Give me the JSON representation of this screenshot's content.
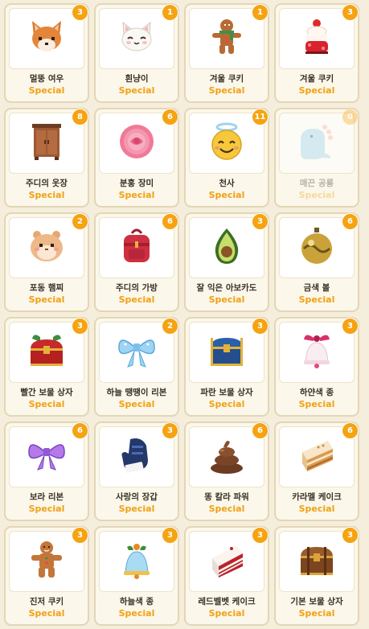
{
  "items": [
    {
      "name": "멀뚱 여우",
      "rarity": "Special",
      "count": "3",
      "icon": "fox-icon",
      "owned": true
    },
    {
      "name": "흰냥이",
      "rarity": "Special",
      "count": "1",
      "icon": "white-cat-icon",
      "owned": true
    },
    {
      "name": "겨울 쿠키",
      "rarity": "Special",
      "count": "1",
      "icon": "gingerbread-icon",
      "owned": true
    },
    {
      "name": "겨울 쿠키",
      "rarity": "Special",
      "count": "3",
      "icon": "cake-cherry-icon",
      "owned": true
    },
    {
      "name": "주디의 옷장",
      "rarity": "Special",
      "count": "8",
      "icon": "wardrobe-icon",
      "owned": true
    },
    {
      "name": "분홍 장미",
      "rarity": "Special",
      "count": "6",
      "icon": "pink-rose-icon",
      "owned": true
    },
    {
      "name": "천사",
      "rarity": "Special",
      "count": "11",
      "icon": "angel-smiley-icon",
      "owned": true
    },
    {
      "name": "매끈 공룡",
      "rarity": "Special",
      "count": "0",
      "icon": "dinosaur-icon",
      "owned": false
    },
    {
      "name": "포동 햄찌",
      "rarity": "Special",
      "count": "2",
      "icon": "hamster-icon",
      "owned": true
    },
    {
      "name": "주디의 가방",
      "rarity": "Special",
      "count": "6",
      "icon": "backpack-icon",
      "owned": true
    },
    {
      "name": "잘 익은 아보카도",
      "rarity": "Special",
      "count": "3",
      "icon": "avocado-icon",
      "owned": true
    },
    {
      "name": "금색 볼",
      "rarity": "Special",
      "count": "6",
      "icon": "gold-ornament-icon",
      "owned": true
    },
    {
      "name": "빨간 보물 상자",
      "rarity": "Special",
      "count": "3",
      "icon": "red-chest-icon",
      "owned": true
    },
    {
      "name": "하늘 땡땡이 리본",
      "rarity": "Special",
      "count": "2",
      "icon": "blue-bow-icon",
      "owned": true
    },
    {
      "name": "파란 보물 상자",
      "rarity": "Special",
      "count": "3",
      "icon": "blue-chest-icon",
      "owned": true
    },
    {
      "name": "하얀색 종",
      "rarity": "Special",
      "count": "3",
      "icon": "white-bell-icon",
      "owned": true
    },
    {
      "name": "보라 리본",
      "rarity": "Special",
      "count": "6",
      "icon": "purple-bow-icon",
      "owned": true
    },
    {
      "name": "사랑의 장갑",
      "rarity": "Special",
      "count": "3",
      "icon": "mitten-icon",
      "owned": true
    },
    {
      "name": "똥 칼라 파워",
      "rarity": "Special",
      "count": "6",
      "icon": "poop-icon",
      "owned": true
    },
    {
      "name": "카라멜 케이크",
      "rarity": "Special",
      "count": "6",
      "icon": "caramel-cake-icon",
      "owned": true
    },
    {
      "name": "진저 쿠키",
      "rarity": "Special",
      "count": "3",
      "icon": "ginger-cookie-icon",
      "owned": true
    },
    {
      "name": "하늘색 종",
      "rarity": "Special",
      "count": "3",
      "icon": "blue-bell-icon",
      "owned": true
    },
    {
      "name": "레드벨벳 케이크",
      "rarity": "Special",
      "count": "3",
      "icon": "red-velvet-cake-icon",
      "owned": true
    },
    {
      "name": "기본 보물 상자",
      "rarity": "Special",
      "count": "3",
      "icon": "brown-chest-icon",
      "owned": true
    }
  ],
  "colors": {
    "badge": "#f6a312",
    "rarity": "#f1a113",
    "card_border": "#e3d6b4",
    "background": "#f5eedd"
  }
}
